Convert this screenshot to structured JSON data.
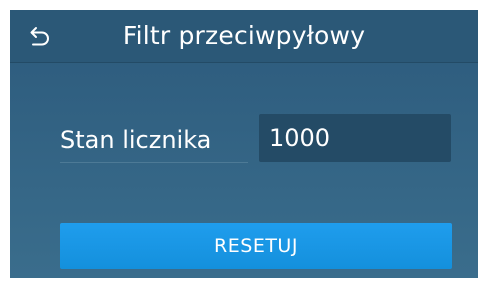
{
  "header": {
    "back_icon": "undo-arrow-icon",
    "title": "Filtr przeciwpyłowy"
  },
  "counter": {
    "label": "Stan licznika",
    "value": "1000"
  },
  "actions": {
    "reset_label": "RESETUJ"
  },
  "colors": {
    "background": "#2c5a7c",
    "header": "#2b5877",
    "value_field": "#244b66",
    "button": "#1b97e6",
    "text": "#ffffff"
  }
}
